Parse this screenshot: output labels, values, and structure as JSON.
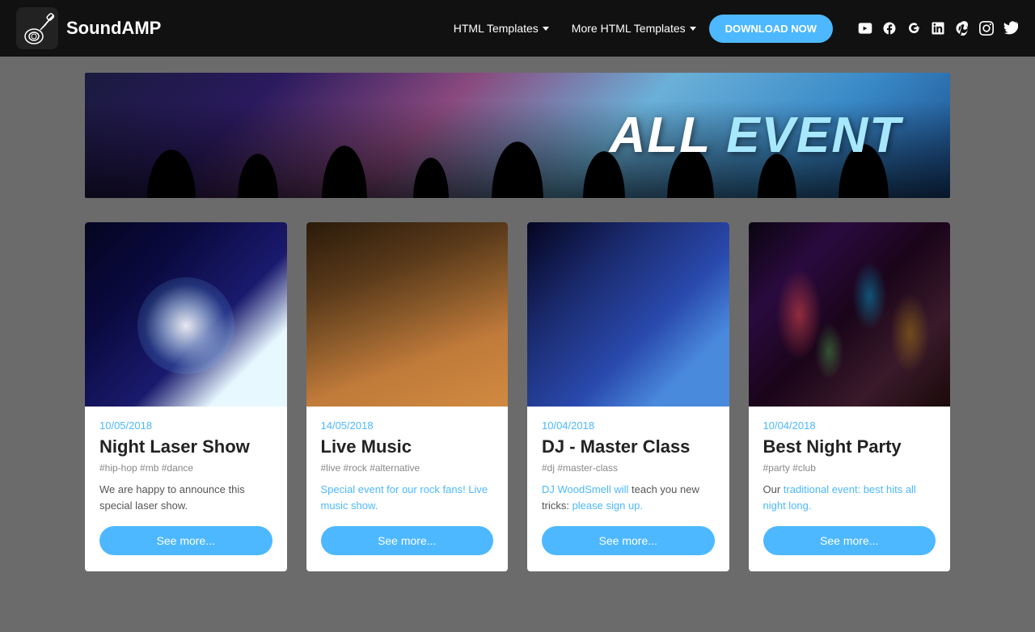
{
  "nav": {
    "logo_text": "SoundAMP",
    "link1": "HTML Templates",
    "link2": "More HTML Templates",
    "download_btn": "DOWNLOAD NOW",
    "social_icons": [
      "yt",
      "fb",
      "gp",
      "li",
      "pi",
      "ig",
      "tw"
    ]
  },
  "hero": {
    "title_part1": "ALL ",
    "title_part2": "EVENT"
  },
  "cards": [
    {
      "date": "10/05/2018",
      "title": "Night Laser Show",
      "tags": "#hip-hop #mb #dance",
      "desc_plain": "We are happy to announce this special laser show.",
      "desc_html": "We are happy to announce this special laser show.",
      "btn": "See more..."
    },
    {
      "date": "14/05/2018",
      "title": "Live Music",
      "tags": "#live #rock #alternative",
      "desc_plain": "Special event for our rock fans! Live music show.",
      "desc_html": "Special event for our rock fans! Live music show.",
      "btn": "See more..."
    },
    {
      "date": "10/04/2018",
      "title": "DJ - Master Class",
      "tags": "#dj #master-class",
      "desc_plain": "DJ WoodSmell will teach you new tricks: please sign up.",
      "desc_link1": "DJ WoodSmell will",
      "desc_link2": "please sign up.",
      "btn": "See more..."
    },
    {
      "date": "10/04/2018",
      "title": "Best Night Party",
      "tags": "#party #club",
      "desc_plain": "Our traditional event: best hits all night long.",
      "desc_link1": "traditional event: best hits all night long.",
      "btn": "See more..."
    }
  ]
}
